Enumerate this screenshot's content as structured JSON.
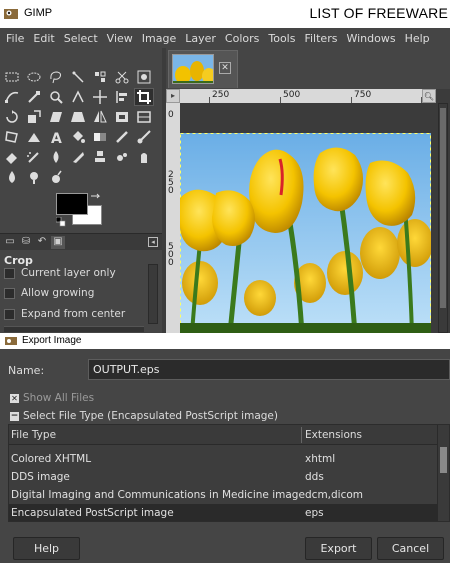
{
  "window": {
    "title": "GIMP",
    "watermark": "LIST OF FREEWARE"
  },
  "menubar": {
    "items": [
      "File",
      "Edit",
      "Select",
      "View",
      "Image",
      "Layer",
      "Colors",
      "Tools",
      "Filters",
      "Windows",
      "Help"
    ]
  },
  "toolbox": {
    "tools": [
      "rect-select-icon",
      "ellipse-select-icon",
      "free-select-icon",
      "fuzzy-select-icon",
      "color-select-icon",
      "scissors-select-icon",
      "foreground-select-icon",
      "paths-icon",
      "color-picker-icon",
      "zoom-icon",
      "measure-icon",
      "move-icon",
      "align-icon",
      "crop-icon",
      "rotate-icon",
      "scale-icon",
      "shear-icon",
      "perspective-icon",
      "flip-icon",
      "cage-icon",
      "warp-icon",
      "unified-transform-icon",
      "handle-transform-icon",
      "text-icon",
      "bucket-fill-icon",
      "gradient-icon",
      "pencil-icon",
      "paintbrush-icon",
      "eraser-icon",
      "airbrush-icon",
      "ink-icon",
      "mypaint-brush-icon",
      "clone-icon",
      "heal-icon",
      "smudge-icon",
      "blur-icon",
      "dodge-burn-icon",
      "smudge-alt-icon"
    ],
    "active_tool": "crop-icon",
    "foreground_color": "#000000",
    "background_color": "#ffffff"
  },
  "tool_options": {
    "title": "Crop",
    "options": [
      {
        "label": "Current layer only",
        "checked": false
      },
      {
        "label": "Allow growing",
        "checked": false
      },
      {
        "label": "Expand from center",
        "checked": false
      }
    ]
  },
  "canvas": {
    "ruler_labels": [
      "250",
      "500",
      "750",
      "1"
    ],
    "vertical_labels": [
      "0",
      "250",
      "500"
    ]
  },
  "export_dialog": {
    "title": "Export Image",
    "name_label": "Name:",
    "name_value": "OUTPUT.eps",
    "show_all_files": "Show All Files",
    "select_file_type": "Select File Type (Encapsulated PostScript image)",
    "columns": [
      "File Type",
      "Extensions"
    ],
    "rows": [
      {
        "type": "Colored XHTML",
        "ext": "xhtml",
        "selected": false
      },
      {
        "type": "DDS image",
        "ext": "dds",
        "selected": false
      },
      {
        "type": "Digital Imaging and Communications in Medicine image",
        "ext": "dcm,dicom",
        "selected": false
      },
      {
        "type": "Encapsulated PostScript image",
        "ext": "eps",
        "selected": true
      }
    ],
    "buttons": {
      "help": "Help",
      "export": "Export",
      "cancel": "Cancel"
    }
  },
  "colors": {
    "background": "#454545",
    "titlebar": "#ffffff",
    "sky": "#7ab6e8",
    "tulip": "#f2c200"
  }
}
